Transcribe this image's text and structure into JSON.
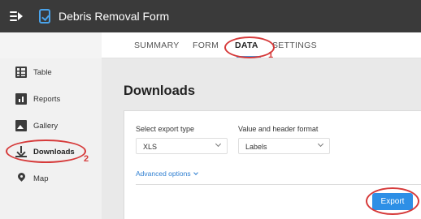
{
  "app": {
    "title": "Debris Removal Form",
    "menu_icon": "menu-collapse-icon",
    "app_icon": "form-check-icon",
    "accent": "#3f9be6"
  },
  "tabs": [
    {
      "label": "SUMMARY",
      "active": false
    },
    {
      "label": "FORM",
      "active": false
    },
    {
      "label": "DATA",
      "active": true
    },
    {
      "label": "SETTINGS",
      "active": false
    }
  ],
  "sidebar": {
    "items": [
      {
        "label": "Table",
        "icon": "table-icon"
      },
      {
        "label": "Reports",
        "icon": "bar-chart-icon"
      },
      {
        "label": "Gallery",
        "icon": "image-icon"
      },
      {
        "label": "Downloads",
        "icon": "download-icon",
        "active": true
      },
      {
        "label": "Map",
        "icon": "map-pin-icon"
      }
    ]
  },
  "downloads": {
    "heading": "Downloads",
    "export_type": {
      "label": "Select export type",
      "value": "XLS"
    },
    "format": {
      "label": "Value and header format",
      "value": "Labels"
    },
    "advanced_label": "Advanced options",
    "export_button": "Export"
  },
  "annotations": {
    "color": "#d63a3a",
    "markers": [
      "1",
      "2"
    ]
  }
}
